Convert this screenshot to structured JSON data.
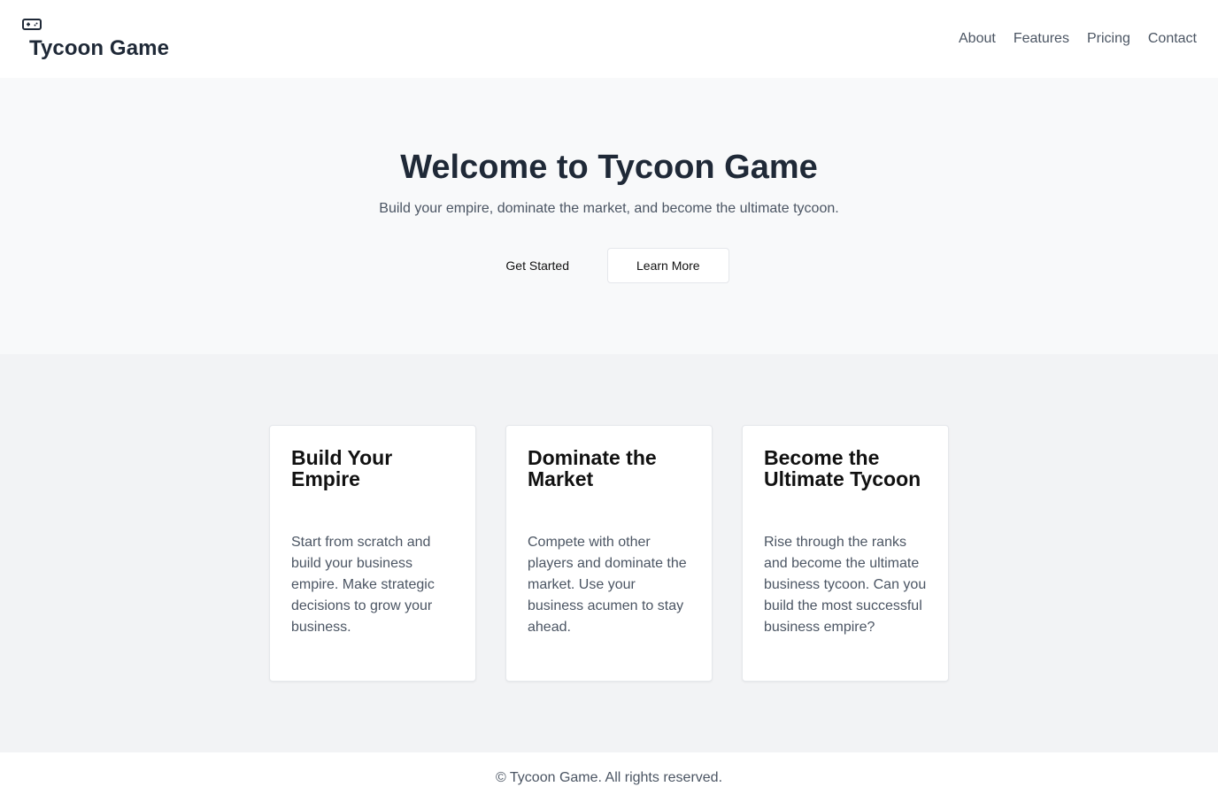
{
  "header": {
    "brand_icon": "gamepad-icon",
    "brand_title": "Tycoon Game",
    "nav": [
      "About",
      "Features",
      "Pricing",
      "Contact"
    ]
  },
  "hero": {
    "title": "Welcome to Tycoon Game",
    "subtitle": "Build your empire, dominate the market, and become the ultimate tycoon.",
    "primary_button": "Get Started",
    "secondary_button": "Learn More"
  },
  "features": [
    {
      "title": "Build Your Empire",
      "description": "Start from scratch and build your business empire. Make strategic decisions to grow your business."
    },
    {
      "title": "Dominate the Market",
      "description": "Compete with other players and dominate the market. Use your business acumen to stay ahead."
    },
    {
      "title": "Become the Ultimate Tycoon",
      "description": "Rise through the ranks and become the ultimate business tycoon. Can you build the most successful business empire?"
    }
  ],
  "footer": {
    "text": "© Tycoon Game. All rights reserved."
  },
  "colors": {
    "header_bg": "#ffffff",
    "hero_bg": "#f8f9fa",
    "features_bg": "#f2f3f5",
    "title_text": "#1f2937",
    "body_text": "#4b5563"
  }
}
